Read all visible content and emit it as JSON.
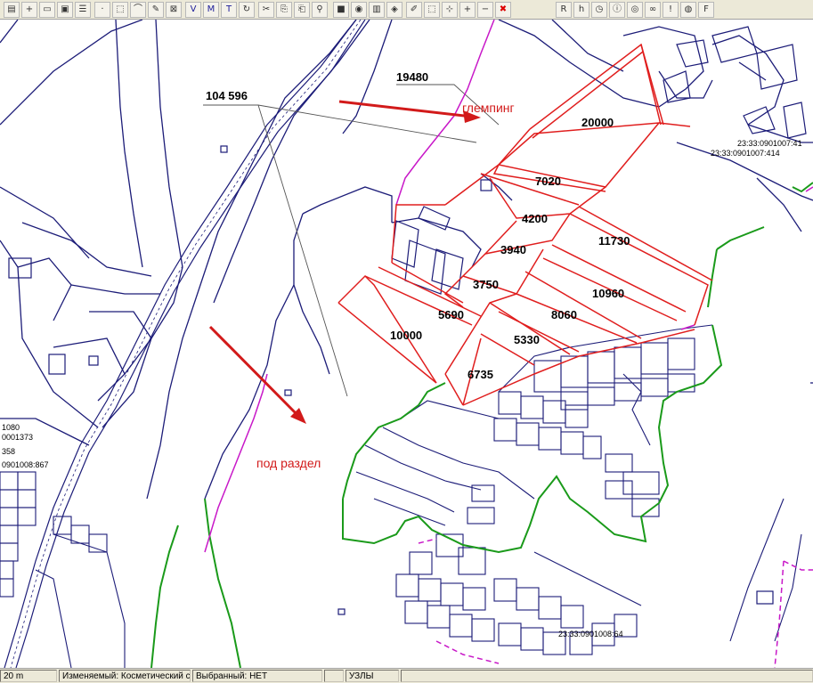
{
  "toolbar": {
    "buttons": [
      "layer-list",
      "layer-add",
      "window",
      "map-view",
      "table",
      "point-tool",
      "select-tool",
      "measure-tool",
      "edit-tool",
      "delete-tool",
      "map-v",
      "map-m",
      "map-t",
      "refresh",
      "cut",
      "copy",
      "paste",
      "link",
      "stop",
      "object-info",
      "statistics",
      "layers-tool",
      "drawing",
      "select-rect",
      "node-edit",
      "add-node",
      "subtract-node",
      "delete-red",
      "r-button",
      "h-button",
      "clock",
      "info",
      "eye",
      "chain",
      "exclamation",
      "lock",
      "f-button"
    ]
  },
  "map": {
    "total_area_label": "104 596",
    "camping_area_label": "19480",
    "notes": {
      "camping": "глемпинг",
      "division": "под раздел"
    },
    "colors": {
      "parcel_red": "#e01e1e",
      "boundary_navy": "#1c1c78",
      "zone_green": "#1a9a1a",
      "line_magenta": "#c818c8",
      "arrow_red": "#d21a1a"
    },
    "plots": [
      {
        "id": "plot-20000",
        "area": "20000"
      },
      {
        "id": "plot-7020",
        "area": "7020"
      },
      {
        "id": "plot-4200",
        "area": "4200"
      },
      {
        "id": "plot-11730",
        "area": "11730"
      },
      {
        "id": "plot-3940",
        "area": "3940"
      },
      {
        "id": "plot-3750",
        "area": "3750"
      },
      {
        "id": "plot-10960",
        "area": "10960"
      },
      {
        "id": "plot-5690",
        "area": "5690"
      },
      {
        "id": "plot-8060",
        "area": "8060"
      },
      {
        "id": "plot-10000",
        "area": "10000"
      },
      {
        "id": "plot-5330",
        "area": "5330"
      },
      {
        "id": "plot-6735",
        "area": "6735"
      }
    ],
    "cadastral": {
      "c1": "23:33:0901007:41",
      "c2": "23:33:0901007:414",
      "c3": "23:33:0901008:64",
      "c4": "1080",
      "c5": "0001373",
      "c6": "358",
      "c7": "0901008:867"
    }
  },
  "status": {
    "scale": "20 m",
    "editable": "Изменяемый: Косметический с",
    "selected": "Выбранный: НЕТ",
    "mode": "УЗЛЫ"
  }
}
